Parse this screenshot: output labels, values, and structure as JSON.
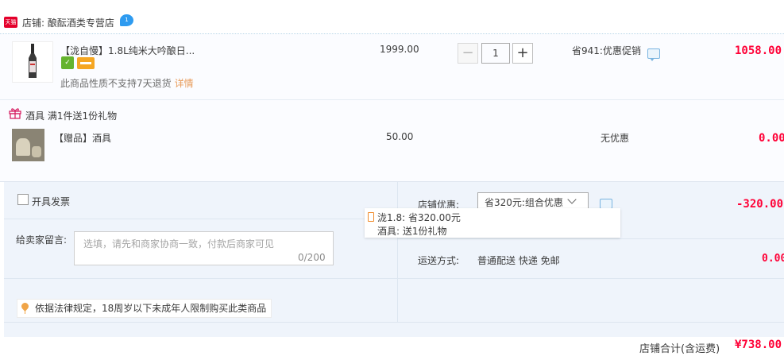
{
  "shop": {
    "badge": "天猫",
    "name": "店铺: 酿酝酒类专营店",
    "chat_badge": "1"
  },
  "product": {
    "title": "【泷自慢】1.8L纯米大吟酿日...",
    "service_icons": [
      "guarantee-icon",
      "card-icon"
    ],
    "return_note": "此商品性质不支持7天退货",
    "detail_link": "详情",
    "unit_price": "1999.00",
    "quantity": "1",
    "minus_label": "−",
    "plus_label": "+",
    "promo": "省941:优惠促销",
    "total": "1058.00"
  },
  "gift": {
    "title": "酒具   满1件送1份礼物",
    "name": "【赠品】酒具",
    "price": "50.00",
    "discount": "无优惠",
    "total": "0.00"
  },
  "order": {
    "invoice_label": "开具发票",
    "memo_label": "给卖家留言:",
    "memo_placeholder": "选填，请先和商家协商一致，付款后商家可见",
    "memo_count": "0/200",
    "law_note": "依据法律规定，18周岁以下未成年人限制购买此类商品",
    "shop_discount_label": "店铺优惠:",
    "shop_discount_selected": "省320元:组合优惠",
    "shop_discount_amount": "-320.00",
    "popover_line1": "泷1.8:  省320.00元",
    "popover_line2": "酒具: 送1份礼物",
    "shipping_label": "运送方式:",
    "shipping_value": "普通配送 快递 免邮",
    "shipping_amount": "0.00",
    "subtotal_label": "店铺合计(含运费)",
    "subtotal_value": "¥738.00"
  },
  "colors": {
    "price_red": "#ff0036",
    "accent_blue": "#2e9bf0",
    "tmall_red": "#e4002b"
  }
}
